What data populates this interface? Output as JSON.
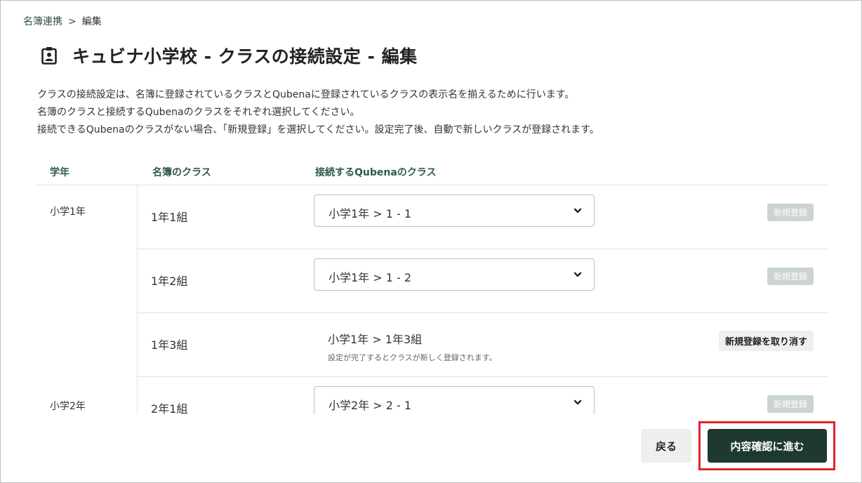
{
  "breadcrumb": {
    "parent": "名簿連携",
    "separator": ">",
    "current": "編集"
  },
  "page": {
    "title": "キュビナ小学校 - クラスの接続設定 - 編集",
    "icon": "id-badge-icon"
  },
  "description": [
    "クラスの接続設定は、名簿に登録されているクラスとQubenaに登録されているクラスの表示名を揃えるために行います。",
    "名簿のクラスと接続するQubenaのクラスをそれぞれ選択してください。",
    "接続できるQubenaのクラスがない場合、「新規登録」を選択してください。設定完了後、自動で新しいクラスが登録されます。"
  ],
  "table": {
    "headers": {
      "grade": "学年",
      "meibo_class": "名簿のクラス",
      "qubena_class": "接続するQubenaのクラス"
    },
    "groups": [
      {
        "grade": "小学1年",
        "rows": [
          {
            "meibo_class": "1年1組",
            "qubena_select": "小学1年 > 1 - 1",
            "action": "新規登録"
          },
          {
            "meibo_class": "1年2組",
            "qubena_select": "小学1年 > 1 - 2",
            "action": "新規登録"
          },
          {
            "meibo_class": "1年3組",
            "qubena_static": "小学1年 > 1年3組",
            "note": "設定が完了するとクラスが新しく登録されます。",
            "action": "新規登録を取り消す"
          }
        ]
      },
      {
        "grade": "小学2年",
        "rows": [
          {
            "meibo_class": "2年1組",
            "qubena_select": "小学2年 > 2 - 1",
            "action": "新規登録"
          }
        ]
      }
    ]
  },
  "buttons": {
    "back": "戻る",
    "next": "内容確認に進む"
  },
  "colors": {
    "accent": "#1e3a2e",
    "header_text": "#2e5a45",
    "highlight": "#e0242f",
    "badge_disabled": "#cbd4d0"
  }
}
